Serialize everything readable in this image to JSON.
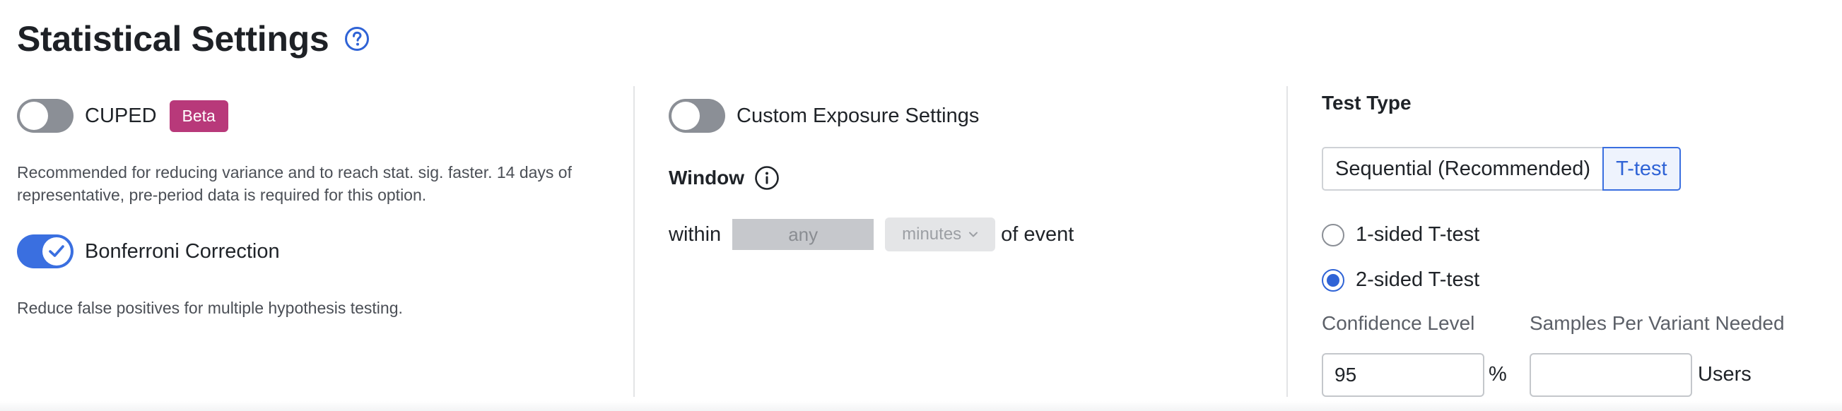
{
  "title": "Statistical Settings",
  "colors": {
    "accent": "#3a6fe0",
    "badge": "#b8397a",
    "toggle_off": "#8b8f96"
  },
  "left": {
    "cuped": {
      "label": "CUPED",
      "badge": "Beta",
      "enabled": false,
      "description": "Recommended for reducing variance and to reach stat. sig. faster. 14 days of representative, pre-period data is required for this option."
    },
    "bonferroni": {
      "label": "Bonferroni Correction",
      "enabled": true,
      "description": "Reduce false positives for multiple hypothesis testing."
    }
  },
  "middle": {
    "custom_exposure": {
      "label": "Custom Exposure Settings",
      "enabled": false
    },
    "window": {
      "label": "Window",
      "within_label": "within",
      "value": "any",
      "unit": "minutes",
      "suffix": "of event"
    }
  },
  "right": {
    "test_type_label": "Test Type",
    "options": [
      "Sequential (Recommended)",
      "T-test"
    ],
    "selected_option": "T-test",
    "radios": [
      {
        "label": "1-sided T-test",
        "checked": false
      },
      {
        "label": "2-sided T-test",
        "checked": true
      }
    ],
    "confidence_label": "Confidence Level",
    "confidence_value": "95",
    "confidence_unit": "%",
    "samples_label": "Samples Per Variant Needed",
    "samples_value": "",
    "samples_unit": "Users"
  }
}
